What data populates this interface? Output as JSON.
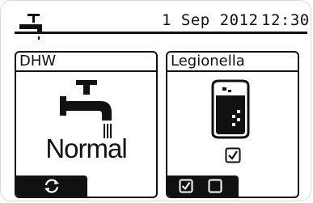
{
  "header": {
    "date": "1 Sep 2012",
    "time": "12:30",
    "icon": "tap-icon"
  },
  "panels": {
    "dhw": {
      "title": "DHW",
      "icon": "tap-icon",
      "mode": "Normal",
      "footer_icon": "refresh-icon"
    },
    "legionella": {
      "title": "Legionella",
      "icon": "tank-icon",
      "checked": true,
      "footer_icons": [
        "checkbox-checked-icon",
        "checkbox-empty-icon"
      ]
    }
  },
  "colors": {
    "foreground": "#111111",
    "background": "#ffffff"
  }
}
